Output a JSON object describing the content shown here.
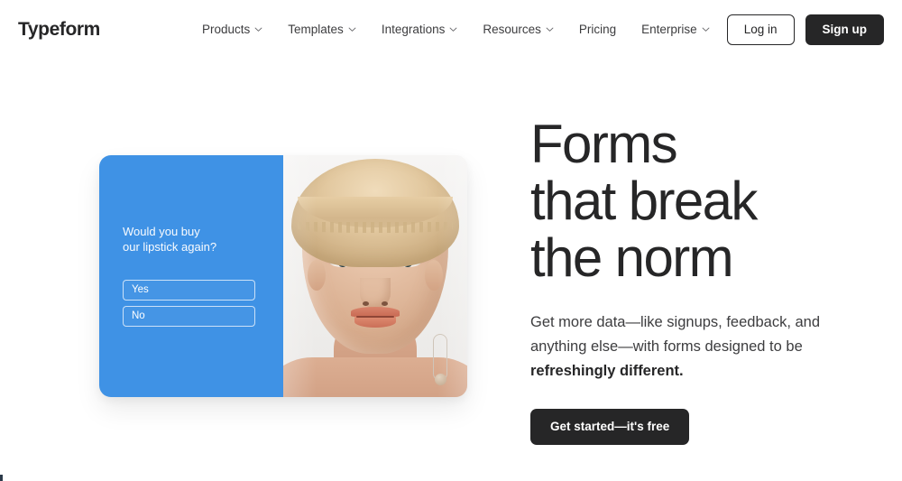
{
  "header": {
    "logo": "Typeform",
    "nav_items": [
      {
        "label": "Products",
        "has_chevron": true
      },
      {
        "label": "Templates",
        "has_chevron": true
      },
      {
        "label": "Integrations",
        "has_chevron": true
      },
      {
        "label": "Resources",
        "has_chevron": true
      },
      {
        "label": "Pricing",
        "has_chevron": false
      },
      {
        "label": "Enterprise",
        "has_chevron": true
      }
    ],
    "login_label": "Log in",
    "signup_label": "Sign up"
  },
  "hero": {
    "headline": "Forms\nthat break\nthe norm",
    "subtext_prefix": "Get more data—like signups, feedback, and anything else—with forms designed to be ",
    "subtext_bold": "refreshingly different.",
    "cta_label": "Get started—it's free"
  },
  "preview_card": {
    "question": "Would you buy\nour lipstick again?",
    "answers": [
      "Yes",
      "No"
    ],
    "panel_color": "#3f92e5",
    "image_alt": "portrait of a person with short blonde hair and pink eyeshadow"
  },
  "colors": {
    "ink": "#262627",
    "body_text": "#3d3d3f",
    "accent_blue": "#3f92e5",
    "page_bg": "#ffffff"
  }
}
